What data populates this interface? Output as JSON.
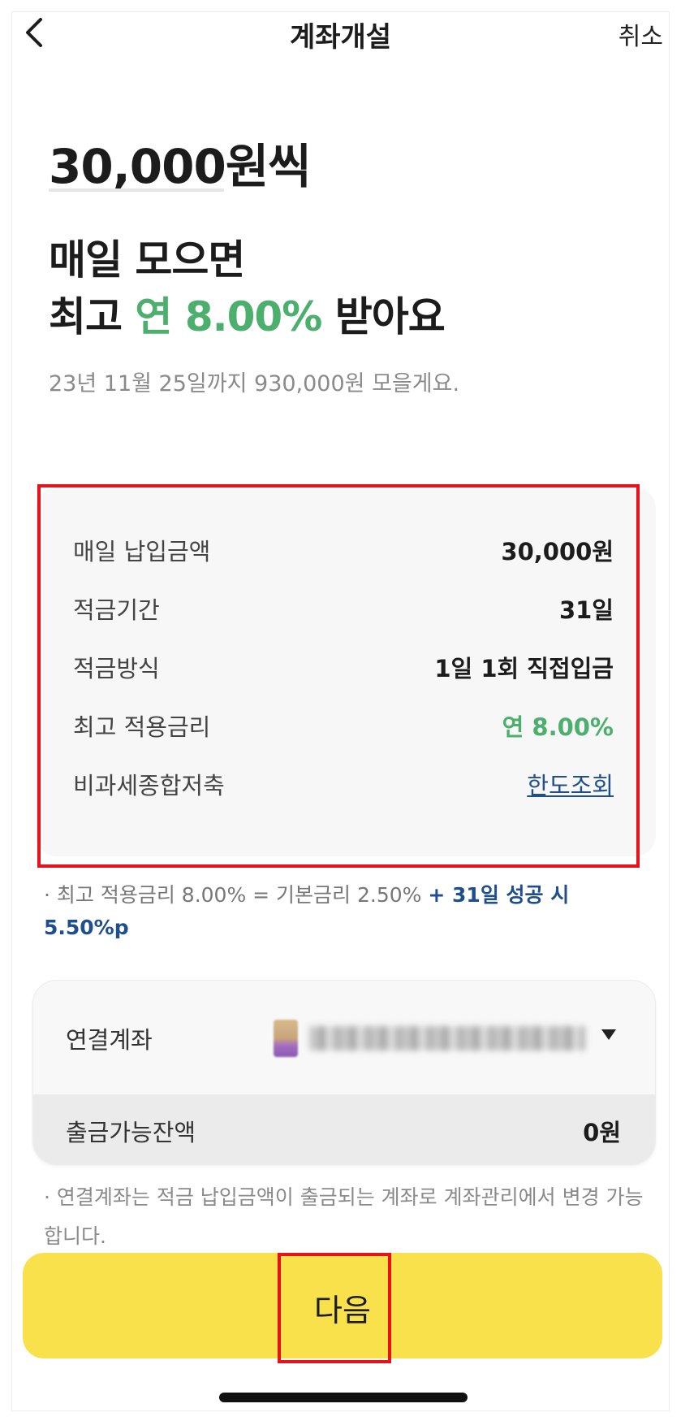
{
  "header": {
    "title": "계좌개설",
    "cancel_label": "취소",
    "back_icon": "chevron-left-icon"
  },
  "hero": {
    "amount": "30,000원씩",
    "line1": "매일 모으면",
    "line2_prefix": "최고 ",
    "line2_rate": "연 8.00%",
    "line2_suffix": " 받아요",
    "subtext": "23년 11월 25일까지 930,000원 모을게요."
  },
  "details": [
    {
      "label": "매일 납입금액",
      "value": "30,000원"
    },
    {
      "label": "적금기간",
      "value": "31일"
    },
    {
      "label": "적금방식",
      "value": "1일 1회 직접입금"
    },
    {
      "label": "최고 적용금리",
      "value": "연 8.00%"
    },
    {
      "label": "비과세종합저축",
      "value": "한도조회"
    }
  ],
  "rate_note": {
    "part1": "· 최고 적용금리 8.00% = 기본금리 2.50% ",
    "part2": "+ 31일 성공 시 5.50%p"
  },
  "account": {
    "linked_label": "연결계좌",
    "balance_label": "출금가능잔액",
    "balance_value": "0원"
  },
  "account_note": "· 연결계좌는 적금 납입금액이 출금되는 계좌로 계좌관리에서 변경 가능합니다.",
  "next_button": "다음",
  "colors": {
    "accent_green": "#4caf6e",
    "link_blue": "#1f4e8c",
    "button_yellow": "#f9e14b",
    "highlight_red": "#e8121c"
  }
}
